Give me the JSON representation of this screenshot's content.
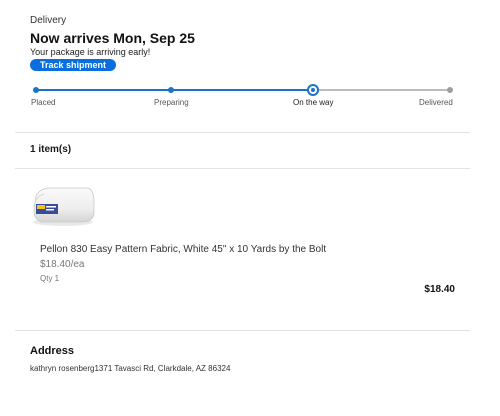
{
  "delivery": {
    "label": "Delivery",
    "title": "Now arrives Mon, Sep 25",
    "subtitle": "Your package is arriving early!",
    "track_button": "Track shipment"
  },
  "progress": {
    "steps": [
      "Placed",
      "Preparing",
      "On the way",
      "Delivered"
    ],
    "current_step": "On the way",
    "colors": {
      "active": "#1a73c8",
      "inactive": "#bdbdbd"
    }
  },
  "items": {
    "count_label": "1 item(s)",
    "list": [
      {
        "name": "Pellon 830 Easy Pattern Fabric, White 45\" x 10 Yards by the Bolt",
        "price_each": "$18.40/ea",
        "qty": "Qty 1",
        "total": "$18.40",
        "image_icon": "fabric-bolt-image"
      }
    ]
  },
  "address": {
    "title": "Address",
    "text": "kathryn rosenberg1371 Tavasci Rd, Clarkdale, AZ 86324"
  },
  "colors": {
    "accent": "#0a6ee0"
  }
}
